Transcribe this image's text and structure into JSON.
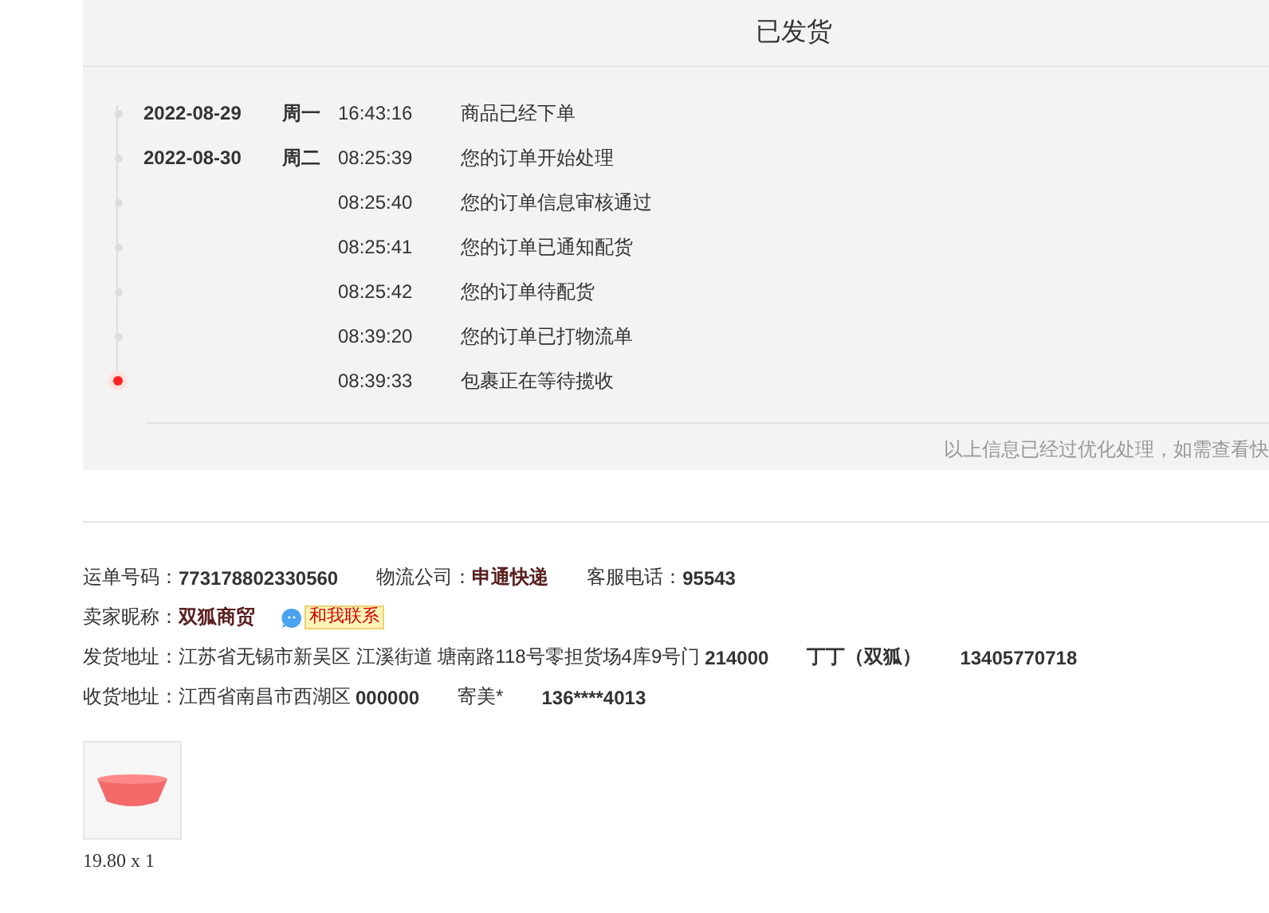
{
  "status_title": "已发货",
  "timeline": [
    {
      "date": "2022-08-29",
      "weekday": "周一",
      "time": "16:43:16",
      "event": "商品已经下单",
      "current": false
    },
    {
      "date": "2022-08-30",
      "weekday": "周二",
      "time": "08:25:39",
      "event": "您的订单开始处理",
      "current": false
    },
    {
      "time": "08:25:40",
      "event": "您的订单信息审核通过",
      "current": false
    },
    {
      "time": "08:25:41",
      "event": "您的订单已通知配货",
      "current": false
    },
    {
      "time": "08:25:42",
      "event": "您的订单待配货",
      "current": false
    },
    {
      "time": "08:39:20",
      "event": "您的订单已打物流单",
      "current": false
    },
    {
      "time": "08:39:33",
      "event": "包裹正在等待揽收",
      "current": true
    }
  ],
  "note": "以上信息已经过优化处理，如需查看快",
  "info": {
    "waybill_label": "运单号码：",
    "waybill": "773178802330560",
    "carrier_label": "物流公司：",
    "carrier": "申通快递",
    "phone_label": "客服电话：",
    "phone": "95543",
    "seller_label": "卖家昵称：",
    "seller": "双狐商贸",
    "contact": "和我联系",
    "ship_label": "发货地址：",
    "ship_address": "江苏省无锡市新吴区 江溪街道 塘南路118号零担货场4库9号门",
    "ship_zip": "214000",
    "ship_name": "丁丁（双狐）",
    "ship_phone": "13405770718",
    "recv_label": "收货地址：",
    "recv_address": "江西省南昌市西湖区",
    "recv_zip": "000000",
    "recv_name": "寄美*",
    "recv_phone": "136****4013"
  },
  "product": {
    "price_qty": "19.80 x 1"
  }
}
